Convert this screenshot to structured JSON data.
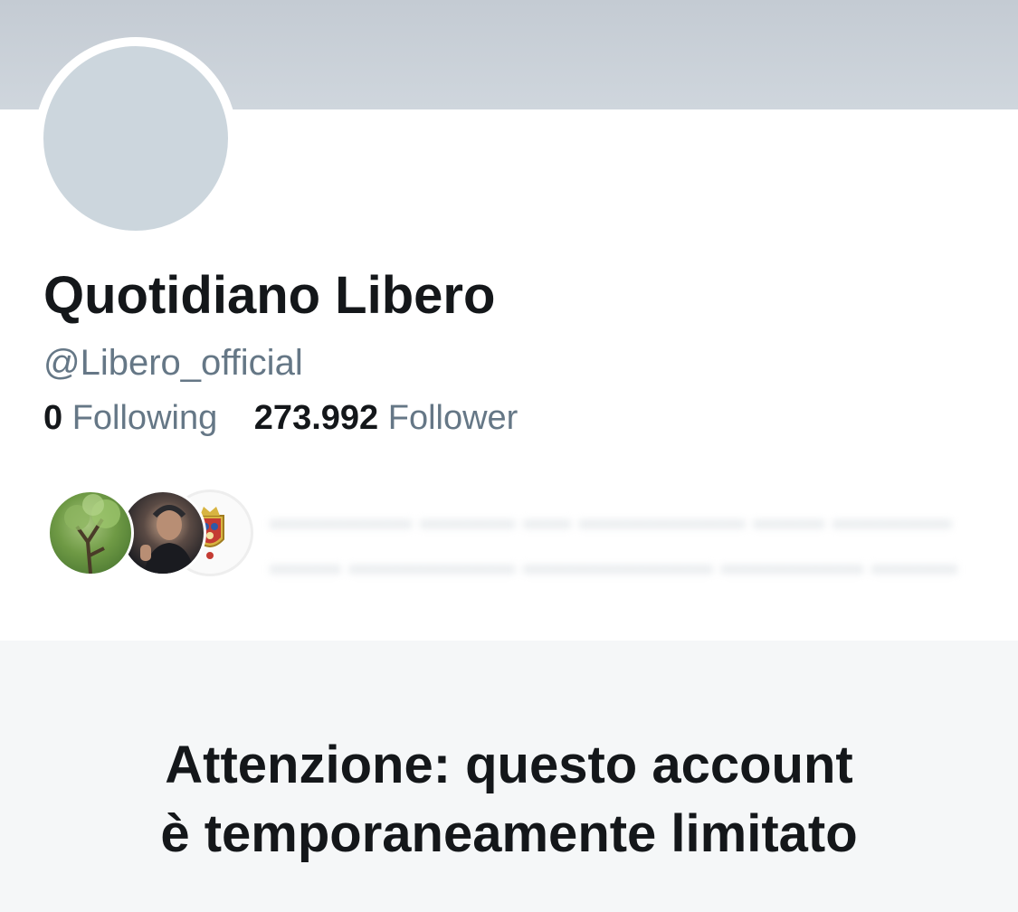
{
  "profile": {
    "name": "Quotidiano Libero",
    "handle": "@Libero_official",
    "stats": {
      "following_count": "0",
      "following_label": "Following",
      "followers_count": "273.992",
      "followers_label": "Follower"
    }
  },
  "notice": {
    "line1": "Attenzione: questo account",
    "line2": "è temporaneamente limitato"
  }
}
